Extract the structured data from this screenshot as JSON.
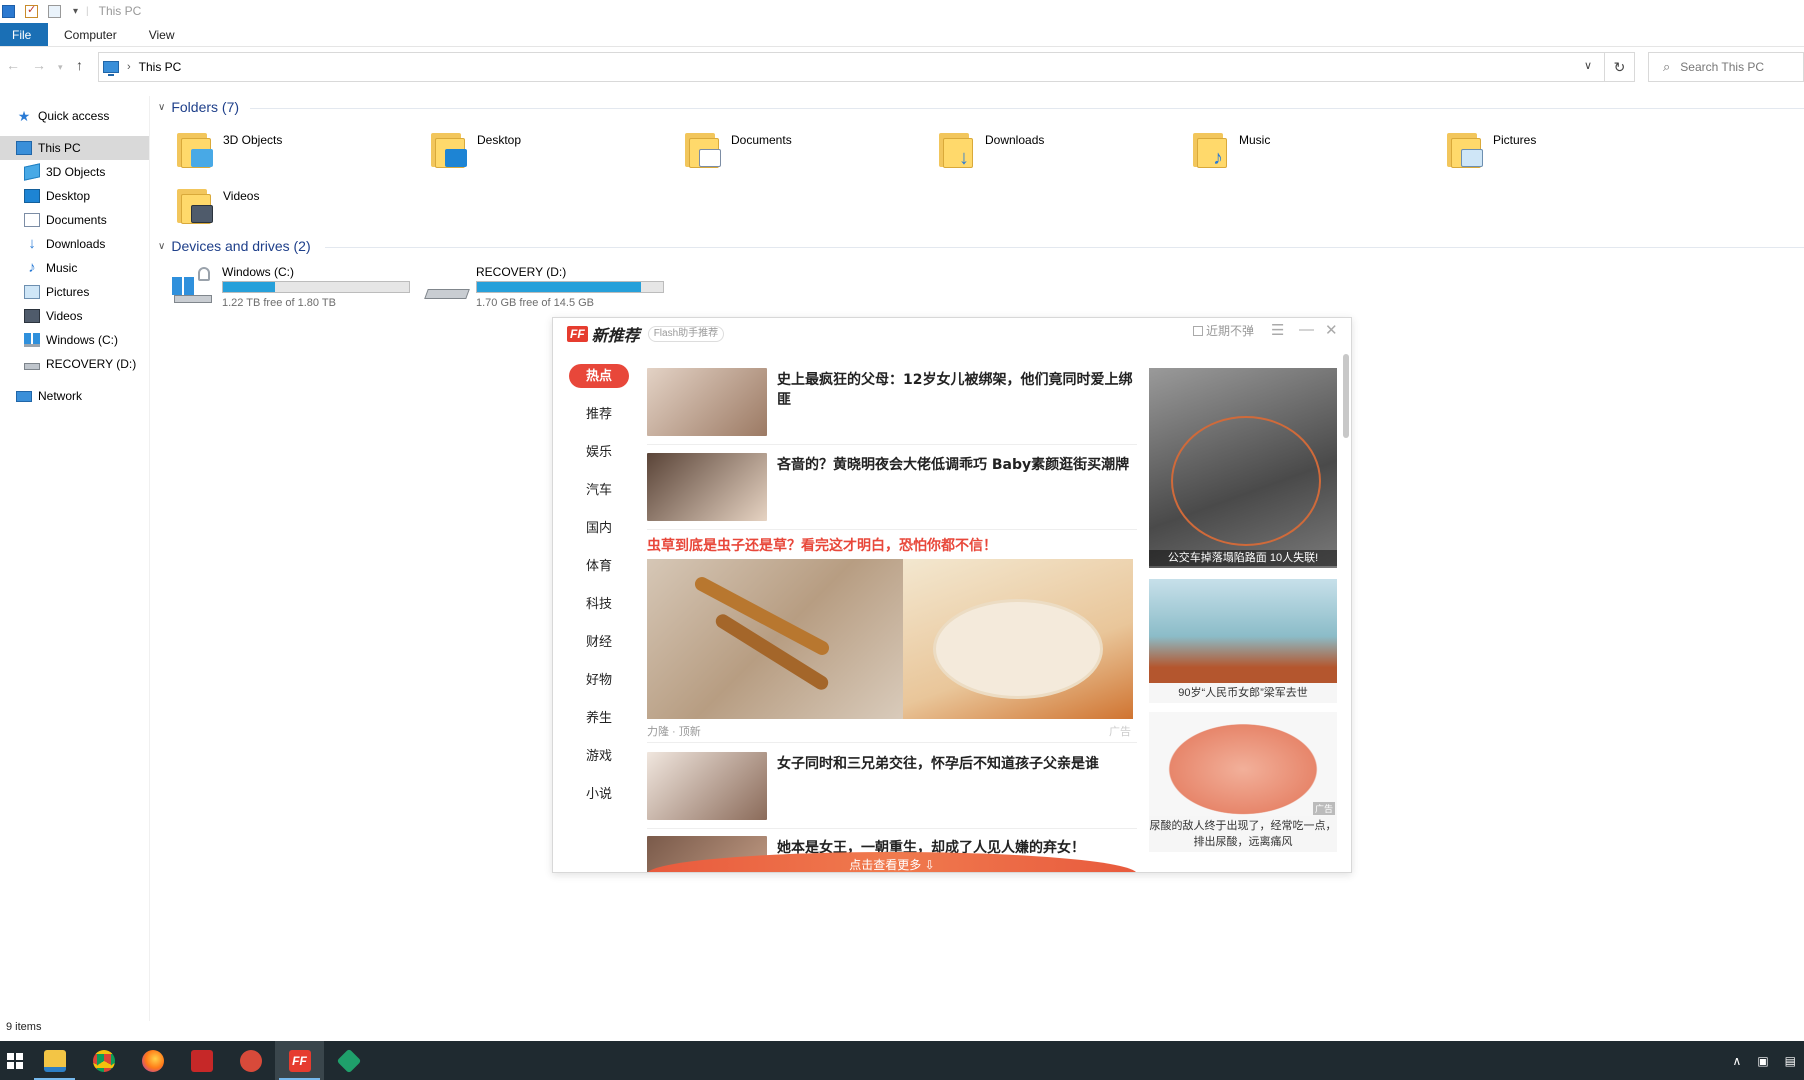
{
  "window": {
    "title": "This PC"
  },
  "ribbon": {
    "tabs": [
      "File",
      "Computer",
      "View"
    ]
  },
  "address": {
    "crumb": "This PC",
    "search_placeholder": "Search This PC"
  },
  "sidebar": {
    "items": [
      {
        "label": "Quick access",
        "icon": "star-icon"
      },
      {
        "label": "This PC",
        "icon": "computer-icon",
        "selected": true
      },
      {
        "label": "3D Objects",
        "icon": "cube-icon"
      },
      {
        "label": "Desktop",
        "icon": "desktop-icon"
      },
      {
        "label": "Documents",
        "icon": "document-icon"
      },
      {
        "label": "Downloads",
        "icon": "download-icon"
      },
      {
        "label": "Music",
        "icon": "music-icon"
      },
      {
        "label": "Pictures",
        "icon": "pictures-icon"
      },
      {
        "label": "Videos",
        "icon": "videos-icon"
      },
      {
        "label": "Windows (C:)",
        "icon": "windows-drive-icon"
      },
      {
        "label": "RECOVERY (D:)",
        "icon": "drive-icon"
      },
      {
        "label": "Network",
        "icon": "network-icon"
      }
    ]
  },
  "folders": {
    "header": "Folders (7)",
    "items": [
      {
        "label": "3D Objects",
        "badge_color": "#48a9e6"
      },
      {
        "label": "Desktop",
        "badge_color": "#1d84d4"
      },
      {
        "label": "Documents",
        "badge_color": "#ffffff"
      },
      {
        "label": "Downloads",
        "badge_color": "#2a7bd5"
      },
      {
        "label": "Music",
        "badge_color": "#2a7bd5"
      },
      {
        "label": "Pictures",
        "badge_color": "#cfe6f7"
      },
      {
        "label": "Videos",
        "badge_color": "#4f5b6b"
      }
    ]
  },
  "drives": {
    "header": "Devices and drives (2)",
    "items": [
      {
        "label": "Windows (C:)",
        "free": "1.22 TB free of 1.80 TB",
        "used_fraction": 0.28
      },
      {
        "label": "RECOVERY (D:)",
        "free": "1.70 GB free of 14.5 GB",
        "used_fraction": 0.88
      }
    ]
  },
  "status": {
    "items": "9 items"
  },
  "popup": {
    "logo": "FF",
    "title": "新推荐",
    "subtitle": "Flash助手推荐",
    "no_popup": "近期不弹",
    "nav": [
      "热点",
      "推荐",
      "娱乐",
      "汽车",
      "国内",
      "体育",
      "科技",
      "财经",
      "好物",
      "养生",
      "游戏",
      "小说"
    ],
    "news": [
      {
        "title": "史上最疯狂的父母：12岁女儿被绑架，他们竟同时爱上绑匪",
        "thumb": "#c9a990"
      },
      {
        "title": "吝啬的？黄晓明夜会大佬低调乖巧 Baby素颜逛街买潮牌",
        "thumb": "#b89a86"
      },
      {
        "title": "女子同时和三兄弟交往，怀孕后不知道孩子父亲是谁",
        "thumb": "#d9c7bb"
      },
      {
        "title": "她本是女王，一朝重生，却成了人见人嫌的弃女！",
        "thumb": "#a9806b"
      }
    ],
    "ad": {
      "title": "虫草到底是虫子还是草？看完这才明白，恐怕你都不信！",
      "source": "力隆 · 顶新",
      "tag": "广告"
    },
    "more": "点击查看更多",
    "side": [
      {
        "caption": "公交车掉落塌陷路面 10人失联!"
      },
      {
        "caption": "90岁“人民币女郎”梁军去世"
      },
      {
        "caption": "尿酸的敌人终于出现了，经常吃一点，排出尿酸，远离痛风",
        "tag": "广告"
      }
    ]
  },
  "taskbar": {
    "apps": [
      "start",
      "file-explorer",
      "chrome",
      "firefox",
      "app-red",
      "app-check",
      "flash-ff",
      "app-green"
    ]
  }
}
